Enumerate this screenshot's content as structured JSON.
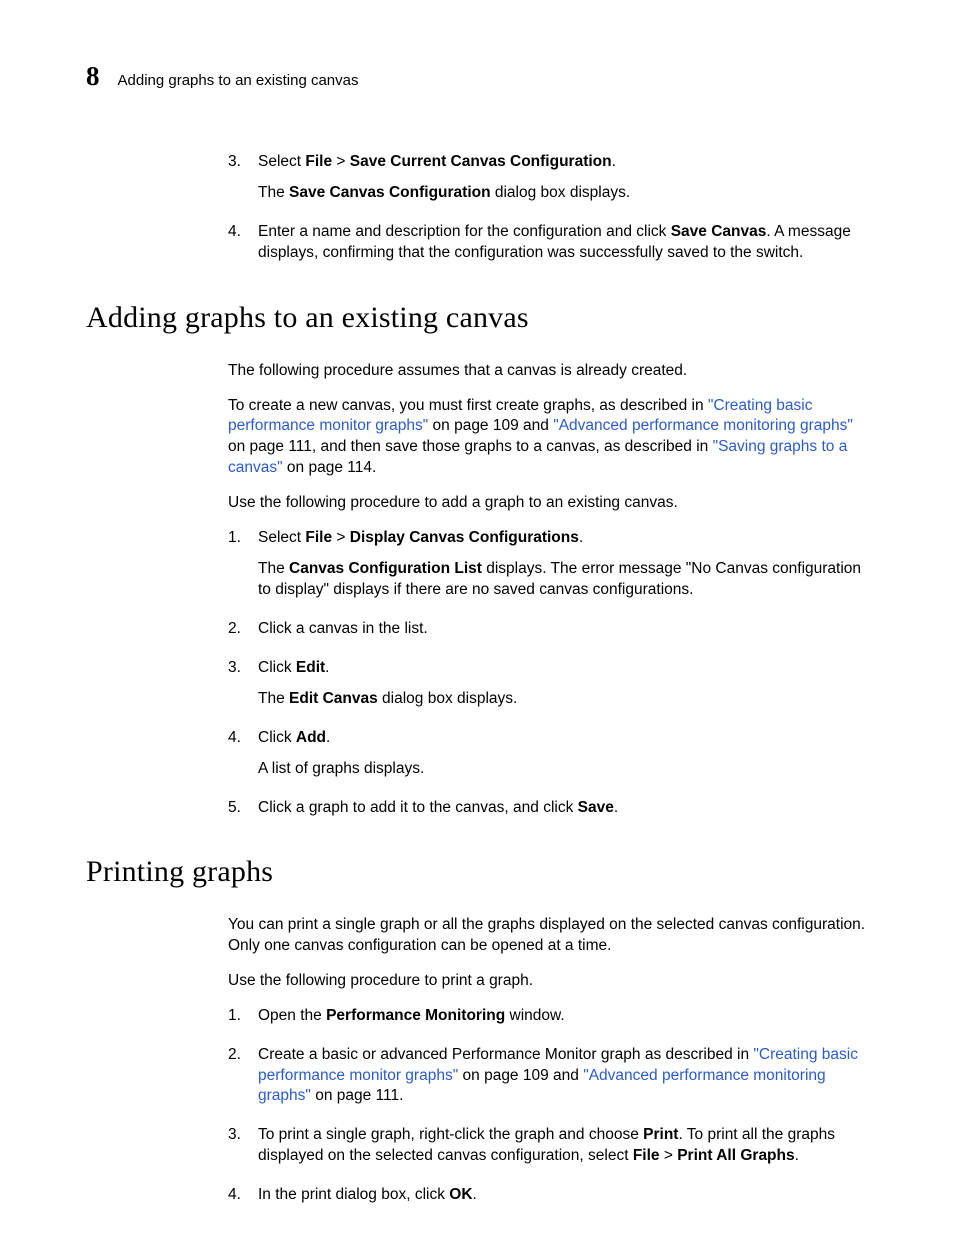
{
  "header": {
    "chapter_number": "8",
    "running_title": "Adding graphs to an existing canvas"
  },
  "top_steps": {
    "s3": {
      "num": "3.",
      "t1": "Select ",
      "file": "File",
      "sep": " > ",
      "cmd": "Save Current Canvas Configuration",
      "t2": ".",
      "sub_a": "The ",
      "sub_b": "Save Canvas Configuration",
      "sub_c": " dialog box displays."
    },
    "s4": {
      "num": "4.",
      "t1": "Enter a name and description for the configuration and click ",
      "btn": "Save Canvas",
      "t2": ". A message displays, confirming that the configuration was successfully saved to the switch."
    }
  },
  "section1": {
    "heading": "Adding graphs to an existing canvas",
    "p1": "The following procedure assumes that a canvas is already created.",
    "p2_a": "To create a new canvas, you must first create graphs, as described in ",
    "p2_link1": "\"Creating basic performance monitor graphs\"",
    "p2_b": " on page 109 and ",
    "p2_link2": "\"Advanced performance monitoring graphs\"",
    "p2_c": " on page 111, and then save those graphs to a canvas, as described in ",
    "p2_link3": "\"Saving graphs to a canvas\"",
    "p2_d": " on page 114.",
    "p3": "Use the following procedure to add a graph to an existing canvas.",
    "steps": {
      "s1": {
        "num": "1.",
        "t1": "Select ",
        "file": "File",
        "sep": " > ",
        "cmd": "Display Canvas Configurations",
        "t2": ".",
        "sub_a": "The ",
        "sub_b": "Canvas Configuration List",
        "sub_c": " displays. The error message \"No Canvas configuration to display\" displays if there are no saved canvas configurations."
      },
      "s2": {
        "num": "2.",
        "t": "Click a canvas in the list."
      },
      "s3": {
        "num": "3.",
        "t1": "Click ",
        "btn": "Edit",
        "t2": ".",
        "sub_a": "The ",
        "sub_b": "Edit Canvas",
        "sub_c": " dialog box displays."
      },
      "s4": {
        "num": "4.",
        "t1": "Click ",
        "btn": "Add",
        "t2": ".",
        "sub": "A list of graphs displays."
      },
      "s5": {
        "num": "5.",
        "t1": "Click a graph to add it to the canvas, and click ",
        "btn": "Save",
        "t2": "."
      }
    }
  },
  "section2": {
    "heading": "Printing graphs",
    "p1": "You can print a single graph or all the graphs displayed on the selected canvas configuration. Only one canvas configuration can be opened at a time.",
    "p2": "Use the following procedure to print a graph.",
    "steps": {
      "s1": {
        "num": "1.",
        "t1": "Open the ",
        "b": "Performance Monitoring",
        "t2": " window."
      },
      "s2": {
        "num": "2.",
        "t1": "Create a basic or advanced Performance Monitor graph as described in ",
        "link1": "\"Creating basic performance monitor graphs\"",
        "t2": " on page 109 and ",
        "link2": "\"Advanced performance monitoring graphs\"",
        "t3": " on page 111."
      },
      "s3": {
        "num": "3.",
        "t1": "To print a single graph, right-click the graph and choose ",
        "b1": "Print",
        "t2": ". To print all the graphs displayed on the selected canvas configuration, select ",
        "file": "File",
        "sep": " > ",
        "cmd": "Print All Graphs",
        "t3": "."
      },
      "s4": {
        "num": "4.",
        "t1": "In the print dialog box, click ",
        "b": "OK",
        "t2": "."
      }
    }
  }
}
